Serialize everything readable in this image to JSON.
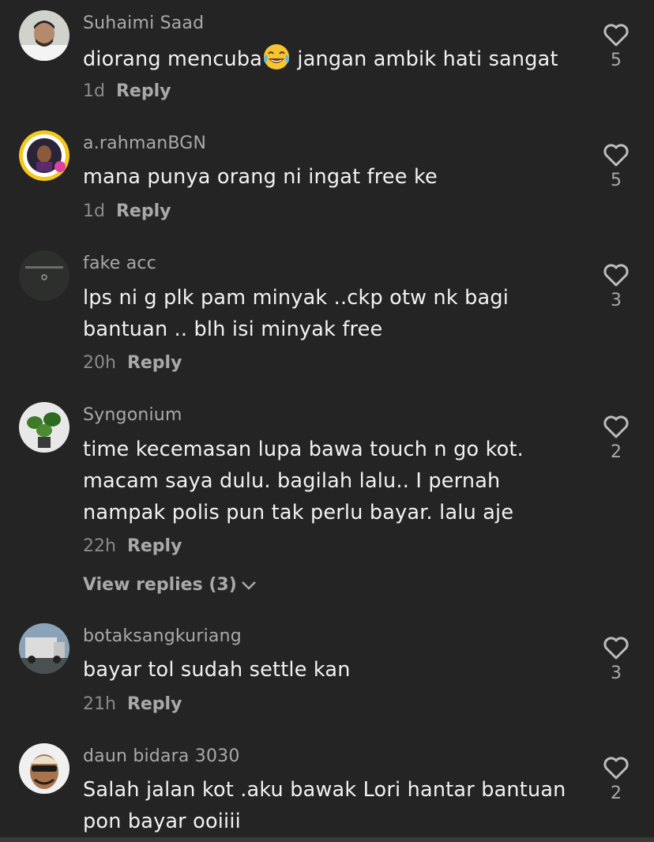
{
  "reply_label": "Reply",
  "comments": [
    {
      "username": "Suhaimi Saad",
      "text_before_emoji": "diorang mencuba",
      "emoji": "face-with-tears-of-joy",
      "text_after_emoji": " jangan ambik hati sangat",
      "time": "1d",
      "likes": "5"
    },
    {
      "username": "a.rahmanBGN",
      "text": "mana punya orang ni ingat free ke",
      "time": "1d",
      "likes": "5"
    },
    {
      "username": "fake acc",
      "text": "lps ni g plk pam minyak ..ckp otw nk bagi bantuan .. blh isi minyak free",
      "time": "20h",
      "likes": "3"
    },
    {
      "username": "Syngonium",
      "text": "time kecemasan lupa bawa touch n go kot. macam saya dulu. bagilah lalu.. I pernah nampak polis pun tak perlu bayar. lalu aje",
      "time": "22h",
      "likes": "2",
      "view_replies": "View replies (3)"
    },
    {
      "username": "botaksangkuriang",
      "text": "bayar tol sudah settle kan",
      "time": "21h",
      "likes": "3"
    },
    {
      "username": "daun bidara 3030",
      "text": "Salah jalan kot .aku bawak Lori hantar bantuan pon bayar ooiiii",
      "likes": "2"
    }
  ],
  "colors": {
    "background": "#242424",
    "username": "#a9a9a9",
    "text": "#f2f2f2",
    "meta": "#8a8a8a"
  }
}
